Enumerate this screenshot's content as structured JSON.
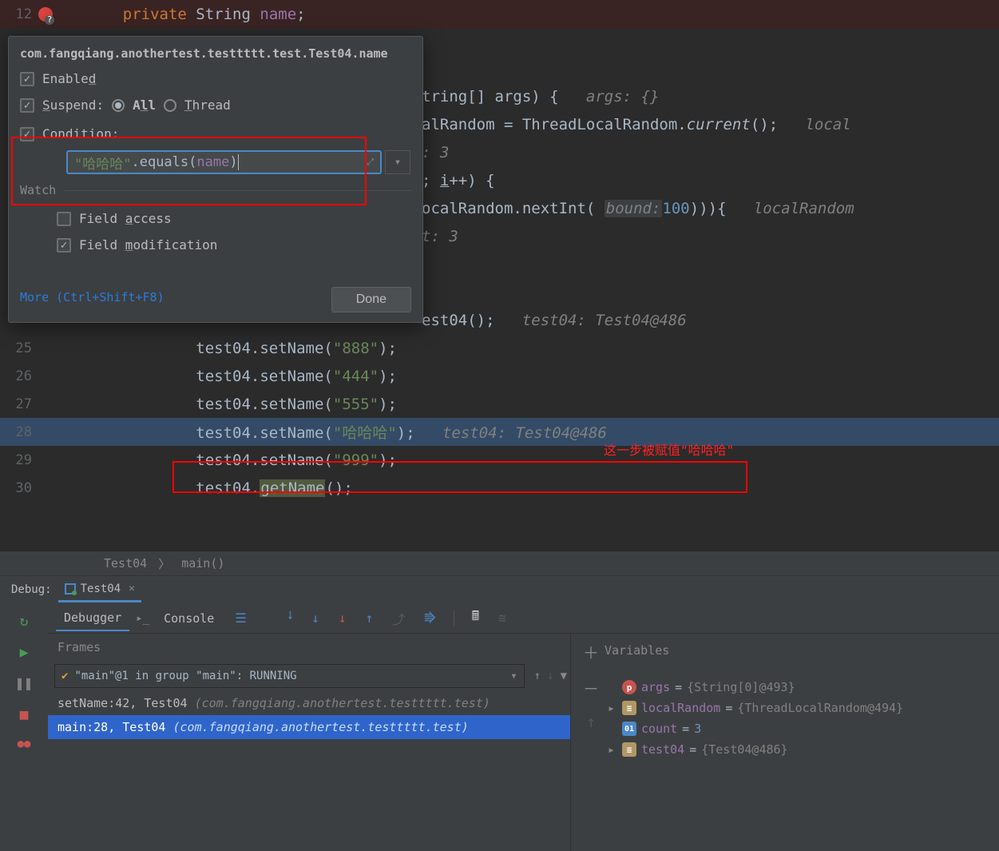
{
  "editor": {
    "line12": {
      "num": "12",
      "kw": "private",
      "type": "String",
      "field": "name",
      "sc": ";"
    },
    "partial_lines": {
      "l15": {
        "text1": "tring[] args) {   ",
        "inlay": "args: {}"
      },
      "l16": {
        "text1": "alRandom = ThreadLocalRandom.",
        "ital": "current",
        "rest": "();   ",
        "inlay": "local"
      },
      "l17": {
        "inlay": ": 3"
      },
      "l18": {
        "text1": "; ",
        "under": "i",
        "rest": "++) {"
      },
      "l19": {
        "text1": "ocalRandom.nextInt( ",
        "param": "bound:",
        "num": "100",
        "rest": "))){   ",
        "inlay": "localRandom"
      },
      "l20": {
        "inlay": "t: 3"
      },
      "l23": {
        "text1": "est04();   ",
        "inlay": "test04: Test04@486"
      }
    },
    "lines": [
      {
        "num": "25",
        "obj": "test04",
        "method": ".setName(",
        "str": "\"888\"",
        "end": ");"
      },
      {
        "num": "26",
        "obj": "test04",
        "method": ".setName(",
        "str": "\"444\"",
        "end": ");"
      },
      {
        "num": "27",
        "obj": "test04",
        "method": ".setName(",
        "str": "\"555\"",
        "end": ");"
      },
      {
        "num": "28",
        "obj": "test04",
        "method": ".setName(",
        "str": "\"哈哈哈\"",
        "end": ");",
        "inlay": "test04: Test04@486",
        "hl": true
      },
      {
        "num": "29",
        "obj": "test04",
        "method": ".setName(",
        "str": "\"999\"",
        "end": ");"
      },
      {
        "num": "30",
        "obj": "test04",
        "method": ".",
        "hlmethod": "getName",
        "end": "();"
      }
    ],
    "annotation": "这一步被赋值\"哈哈哈\""
  },
  "popup": {
    "title": "com.fangqiang.anothertest.testtttt.test.Test04.name",
    "enabled": "Enabled",
    "suspend": "Suspend:",
    "all": "All",
    "thread": "Thread",
    "condition": "Condition:",
    "cond_str": "\"哈哈哈\"",
    "cond_call": ".equals(",
    "cond_arg": "name",
    "cond_close": ")",
    "watch": "Watch",
    "field_access": "Field access",
    "field_mod": "Field modification",
    "more": "More (Ctrl+Shift+F8)",
    "done": "Done"
  },
  "breadcrumb": {
    "cls": "Test04",
    "method": "main()"
  },
  "debug": {
    "label": "Debug:",
    "tab": "Test04",
    "tabs": {
      "debugger": "Debugger",
      "console": "Console"
    },
    "frames": {
      "title": "Frames",
      "thread": "\"main\"@1 in group \"main\": RUNNING",
      "rows": [
        {
          "loc": "setName:42, Test04 ",
          "pkg": "(com.fangqiang.anothertest.testtttt.test)",
          "sel": false
        },
        {
          "loc": "main:28, Test04 ",
          "pkg": "(com.fangqiang.anothertest.testtttt.test)",
          "sel": true
        }
      ]
    },
    "vars": {
      "title": "Variables",
      "rows": [
        {
          "icon": "p",
          "name": "args",
          "eq": " = ",
          "val": "{String[0]@493}"
        },
        {
          "icon": "obj",
          "arrow": true,
          "name": "localRandom",
          "eq": " = ",
          "val": "{ThreadLocalRandom@494}"
        },
        {
          "icon": "int",
          "ilabel": "01",
          "name": "count",
          "eq": " = ",
          "num": "3"
        },
        {
          "icon": "obj",
          "arrow": true,
          "name": "test04",
          "eq": " = ",
          "val": "{Test04@486}"
        }
      ]
    }
  }
}
